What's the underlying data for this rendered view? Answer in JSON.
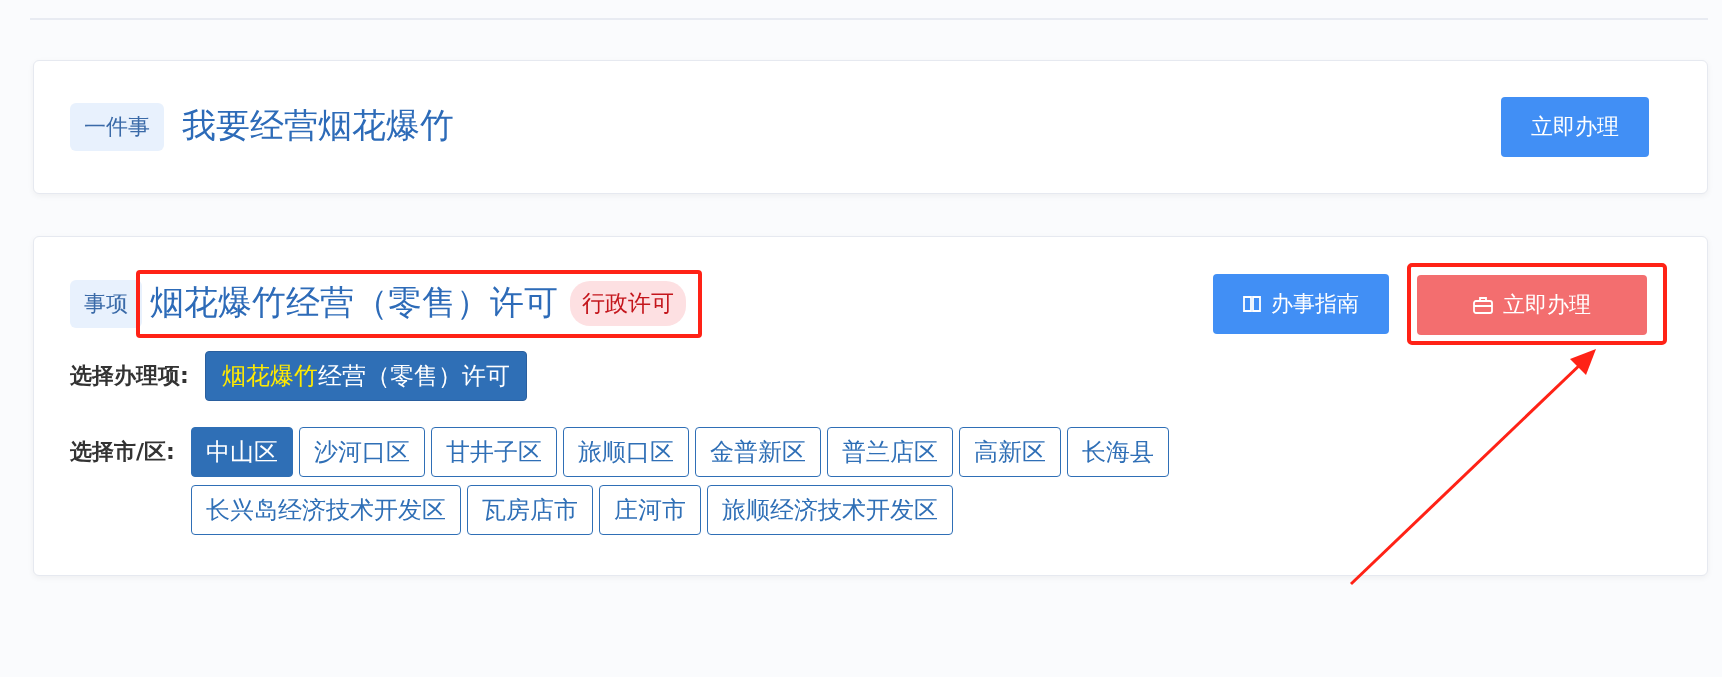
{
  "cards": [
    {
      "tag": "一件事",
      "title": "我要经营烟花爆竹",
      "actions": [
        {
          "kind": "primary",
          "label": "立即办理",
          "highlighted": false
        }
      ]
    },
    {
      "tag": "事项",
      "title": "烟花爆竹经营（零售）许可",
      "title_highlighted": true,
      "badge": "行政许可",
      "actions": [
        {
          "kind": "guide",
          "label": "办事指南",
          "highlighted": false
        },
        {
          "kind": "apply",
          "label": "立即办理",
          "highlighted": true
        }
      ],
      "item_label": "选择办理项:",
      "item": {
        "keyword": "烟花爆竹",
        "rest": "经营（零售）许可"
      },
      "district_label": "选择市/区:",
      "districts": [
        {
          "label": "中山区",
          "selected": true
        },
        {
          "label": "沙河口区",
          "selected": false
        },
        {
          "label": "甘井子区",
          "selected": false
        },
        {
          "label": "旅顺口区",
          "selected": false
        },
        {
          "label": "金普新区",
          "selected": false
        },
        {
          "label": "普兰店区",
          "selected": false
        },
        {
          "label": "高新区",
          "selected": false
        },
        {
          "label": "长海县",
          "selected": false
        },
        {
          "label": "长兴岛经济技术开发区",
          "selected": false
        },
        {
          "label": "瓦房店市",
          "selected": false
        },
        {
          "label": "庄河市",
          "selected": false
        },
        {
          "label": "旅顺经济技术开发区",
          "selected": false
        }
      ],
      "annotation_arrow": true
    }
  ]
}
